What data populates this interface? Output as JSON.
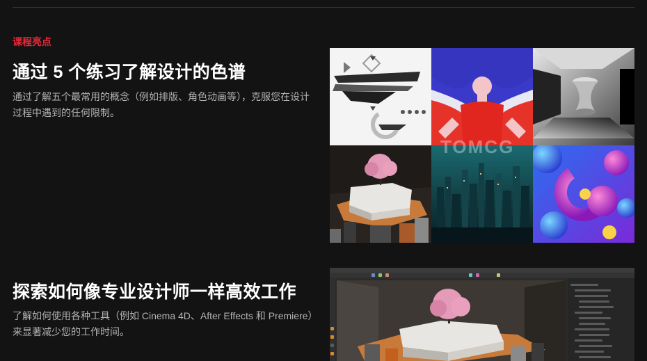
{
  "highlight": {
    "label": "课程亮点",
    "title": "通过 5 个练习了解设计的色谱",
    "description": "通过了解五个最常用的概念（例如排版、角色动画等），克服您在设计过程中遇到的任何限制。"
  },
  "gallery": {
    "watermark": "TOMCG",
    "tiles": [
      "abstract-brush-art",
      "figure-illustration",
      "gradient-geometry",
      "cherry-tree-3d-scene",
      "city-skyline-render",
      "3d-spheres-composition"
    ]
  },
  "workflow": {
    "title": "探索如何像专业设计师一样高效工作",
    "description": "了解如何使用各种工具（例如 Cinema 4D、After Effects 和 Premiere）来显著减少您的工作时间。"
  },
  "colors": {
    "accent": "#e8293a",
    "background": "#131313",
    "body_text": "#b3b3b3"
  }
}
